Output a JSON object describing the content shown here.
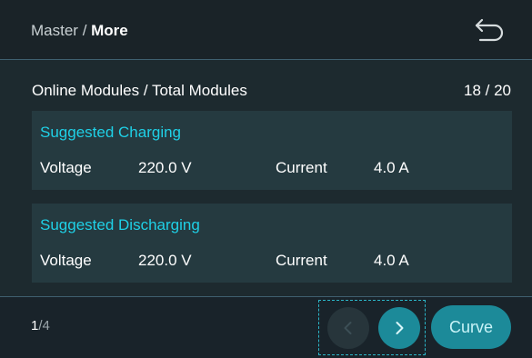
{
  "header": {
    "breadcrumb_parent": "Master",
    "breadcrumb_separator": " / ",
    "breadcrumb_current": "More",
    "back_icon": "undo-arrow-icon"
  },
  "summary": {
    "label": "Online Modules / Total Modules",
    "value": "18 / 20"
  },
  "cards": [
    {
      "title": "Suggested Charging",
      "voltage_label": "Voltage",
      "voltage_value": "220.0 V",
      "current_label": "Current",
      "current_value": "4.0 A"
    },
    {
      "title": "Suggested Discharging",
      "voltage_label": "Voltage",
      "voltage_value": "220.0 V",
      "current_label": "Current",
      "current_value": "4.0 A"
    }
  ],
  "footer": {
    "page_current": "1",
    "page_total": "/4",
    "prev_icon": "chevron-left-icon",
    "next_icon": "chevron-right-icon",
    "curve_label": "Curve"
  },
  "colors": {
    "background": "#1d2a2f",
    "header_bg": "#1a2328",
    "card_bg": "#253a40",
    "accent_cyan": "#1fd0e6",
    "button_teal": "#1c8a99",
    "button_disabled": "#27353b"
  }
}
